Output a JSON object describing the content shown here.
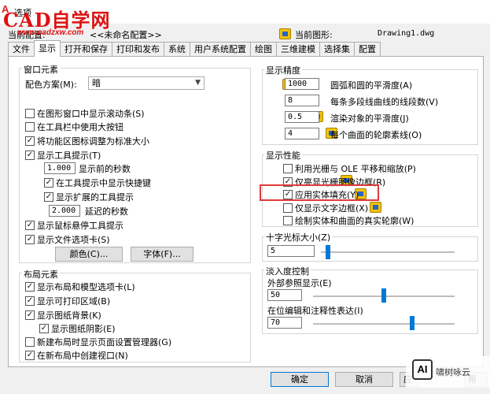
{
  "titlebar": {
    "title": "选项",
    "watermark_title": "CAD自学网",
    "watermark_url": "www.cadzxw.com"
  },
  "profile": {
    "label": "当前配置:",
    "value": "<<未命名配置>>"
  },
  "drawing": {
    "label": "当前图形:",
    "value": "Drawing1.dwg"
  },
  "tabs": [
    "文件",
    "显示",
    "打开和保存",
    "打印和发布",
    "系统",
    "用户系统配置",
    "绘图",
    "三维建模",
    "选择集",
    "配置"
  ],
  "window_elements": {
    "title": "窗口元素",
    "color_scheme_label": "配色方案(M):",
    "color_scheme_value": "暗",
    "items": [
      {
        "label": "在图形窗口中显示滚动条(S)",
        "checked": false
      },
      {
        "label": "在工具栏中使用大按钮",
        "checked": false
      },
      {
        "label": "将功能区图标调整为标准大小",
        "checked": true
      },
      {
        "label": "显示工具提示(T)",
        "checked": true
      }
    ],
    "tooltip_delay_value": "1.000",
    "tooltip_delay_label": "显示前的秒数",
    "shortcut_label": "在工具提示中显示快捷键",
    "shortcut_checked": true,
    "extended_label": "显示扩展的工具提示",
    "extended_checked": true,
    "extended_delay_value": "2.000",
    "extended_delay_label": "延迟的秒数",
    "rollover_label": "显示鼠标悬停工具提示",
    "rollover_checked": true,
    "file_tabs_label": "显示文件选项卡(S)",
    "file_tabs_checked": true,
    "colors_button": "颜色(C)...",
    "fonts_button": "字体(F)..."
  },
  "layout_elements": {
    "title": "布局元素",
    "items": [
      {
        "label": "显示布局和模型选项卡(L)",
        "checked": true
      },
      {
        "label": "显示可打印区域(B)",
        "checked": true
      },
      {
        "label": "显示图纸背景(K)",
        "checked": true
      }
    ],
    "shadow_label": "显示图纸阴影(E)",
    "shadow_checked": true,
    "page_setup_label": "新建布局时显示页面设置管理器(G)",
    "page_setup_checked": false,
    "viewport_label": "在新布局中创建视口(N)",
    "viewport_checked": true
  },
  "display_resolution": {
    "title": "显示精度",
    "items": [
      {
        "value": "1000",
        "label": "圆弧和圆的平滑度(A)"
      },
      {
        "value": "8",
        "label": "每条多段线曲线的线段数(V)"
      },
      {
        "value": "0.5",
        "label": "渲染对象的平滑度(J)"
      },
      {
        "value": "4",
        "label": "每个曲面的轮廓素线(O)"
      }
    ]
  },
  "display_performance": {
    "title": "显示性能",
    "items": [
      {
        "label": "利用光栅与 OLE 平移和缩放(P)",
        "checked": false
      },
      {
        "label": "仅亮显光栅图像边框(R)",
        "checked": true
      },
      {
        "label": "应用实体填充(Y)",
        "checked": true
      },
      {
        "label": "仅显示文字边框(X)",
        "checked": false
      },
      {
        "label": "绘制实体和曲面的真实轮廓(W)",
        "checked": false
      }
    ],
    "highlight_color": "#e03a3a"
  },
  "crosshair": {
    "title": "十字光标大小(Z)",
    "value": "5",
    "percent": 5
  },
  "fade_control": {
    "title": "淡入度控制",
    "xref_label": "外部参照显示(E)",
    "xref_value": "50",
    "xref_percent": 50,
    "inplace_label": "在位编辑和注释性表达(I)",
    "inplace_value": "70",
    "inplace_percent": 70
  },
  "buttons": {
    "ok": "确定",
    "cancel": "取消",
    "apply": "应",
    "help": "帮"
  },
  "badge": {
    "logo": "AI",
    "text": "啸树咏云"
  }
}
